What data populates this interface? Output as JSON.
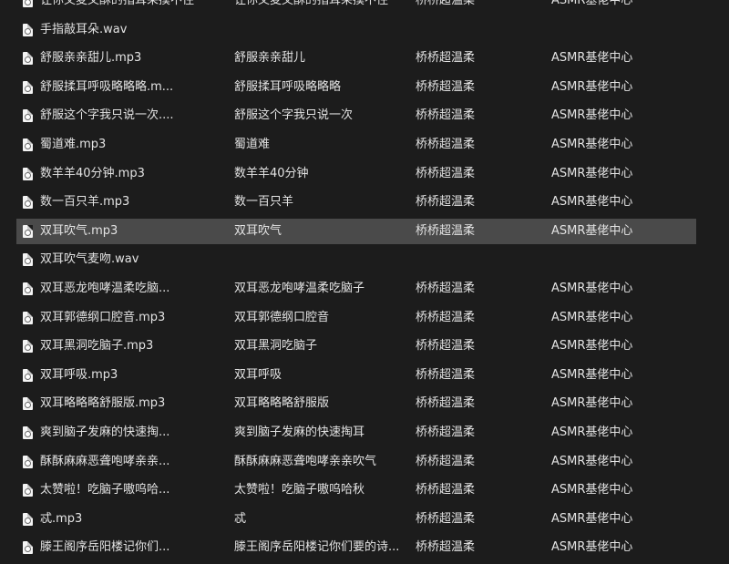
{
  "files": [
    {
      "name": "让你又麦又酥的指耳朵摸不住",
      "title": "让你又麦又酥的指耳朵摸不住",
      "artist": "桥桥超温柔",
      "album": "ASMR基佬中心"
    },
    {
      "name": "手指敲耳朵.wav",
      "title": "",
      "artist": "",
      "album": ""
    },
    {
      "name": "舒服亲亲甜儿.mp3",
      "title": "舒服亲亲甜儿",
      "artist": "桥桥超温柔",
      "album": "ASMR基佬中心"
    },
    {
      "name": "舒服揉耳呼吸略略略.m...",
      "title": "舒服揉耳呼吸略略略",
      "artist": "桥桥超温柔",
      "album": "ASMR基佬中心"
    },
    {
      "name": "舒服这个字我只说一次....",
      "title": "舒服这个字我只说一次",
      "artist": "桥桥超温柔",
      "album": "ASMR基佬中心"
    },
    {
      "name": "蜀道难.mp3",
      "title": "蜀道难",
      "artist": "桥桥超温柔",
      "album": "ASMR基佬中心"
    },
    {
      "name": "数羊羊40分钟.mp3",
      "title": "数羊羊40分钟",
      "artist": "桥桥超温柔",
      "album": "ASMR基佬中心"
    },
    {
      "name": "数一百只羊.mp3",
      "title": "数一百只羊",
      "artist": "桥桥超温柔",
      "album": "ASMR基佬中心"
    },
    {
      "name": "双耳吹气.mp3",
      "title": "双耳吹气",
      "artist": "桥桥超温柔",
      "album": "ASMR基佬中心",
      "selected": true
    },
    {
      "name": "双耳吹气麦吻.wav",
      "title": "",
      "artist": "",
      "album": ""
    },
    {
      "name": "双耳恶龙咆哮温柔吃脑...",
      "title": "双耳恶龙咆哮温柔吃脑子",
      "artist": "桥桥超温柔",
      "album": "ASMR基佬中心"
    },
    {
      "name": "双耳郭德纲口腔音.mp3",
      "title": "双耳郭德纲口腔音",
      "artist": "桥桥超温柔",
      "album": "ASMR基佬中心"
    },
    {
      "name": "双耳黑洞吃脑子.mp3",
      "title": "双耳黑洞吃脑子",
      "artist": "桥桥超温柔",
      "album": "ASMR基佬中心"
    },
    {
      "name": "双耳呼吸.mp3",
      "title": "双耳呼吸",
      "artist": "桥桥超温柔",
      "album": "ASMR基佬中心"
    },
    {
      "name": "双耳略略略舒服版.mp3",
      "title": "双耳略略略舒服版",
      "artist": "桥桥超温柔",
      "album": "ASMR基佬中心"
    },
    {
      "name": "爽到脑子发麻的快速掏...",
      "title": "爽到脑子发麻的快速掏耳",
      "artist": "桥桥超温柔",
      "album": "ASMR基佬中心"
    },
    {
      "name": "酥酥麻麻恶聋咆哮亲亲...",
      "title": "酥酥麻麻恶聋咆哮亲亲吹气",
      "artist": "桥桥超温柔",
      "album": "ASMR基佬中心"
    },
    {
      "name": "太赞啦！吃脑子嗷呜哈...",
      "title": "太赞啦！吃脑子嗷呜哈秋",
      "artist": "桥桥超温柔",
      "album": "ASMR基佬中心"
    },
    {
      "name": "忒.mp3",
      "title": "忒",
      "artist": "桥桥超温柔",
      "album": "ASMR基佬中心"
    },
    {
      "name": "滕王阁序岳阳楼记你们...",
      "title": "滕王阁序岳阳楼记你们要的诗...",
      "artist": "桥桥超温柔",
      "album": "ASMR基佬中心"
    }
  ]
}
